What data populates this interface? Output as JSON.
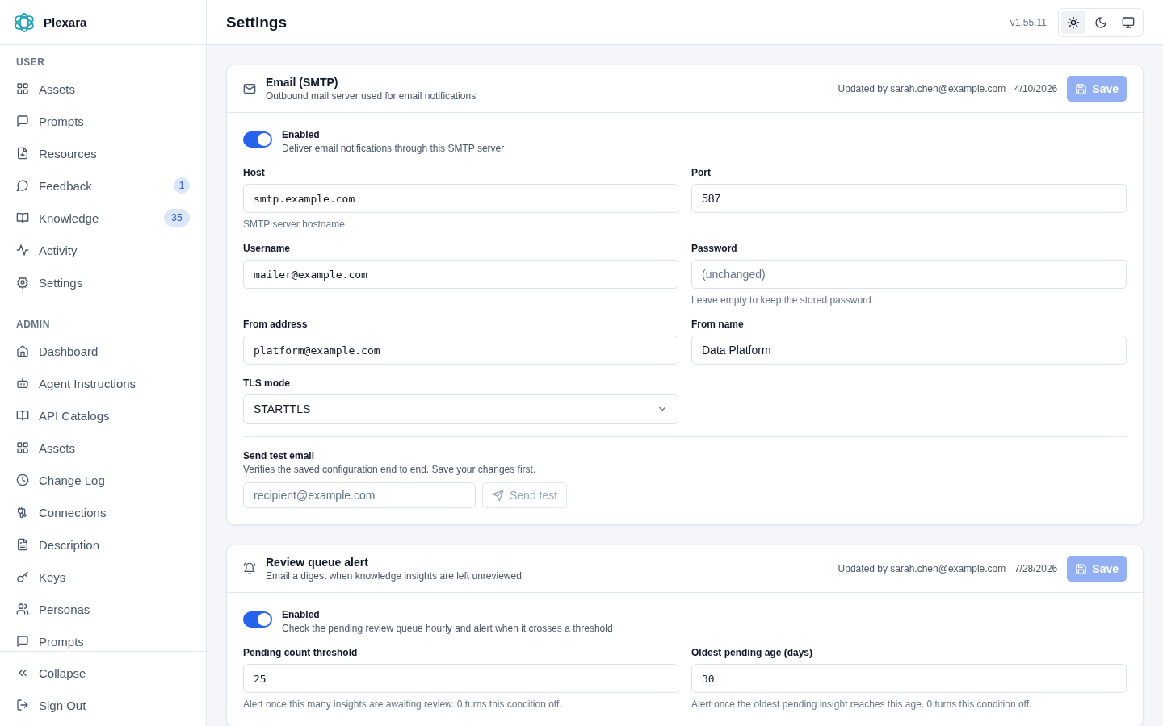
{
  "brand": {
    "name": "Plexara"
  },
  "sidebar": {
    "sections": [
      {
        "title": "USER",
        "items": [
          {
            "label": "Assets",
            "selected": false
          },
          {
            "label": "Prompts",
            "selected": false
          },
          {
            "label": "Resources",
            "selected": false
          },
          {
            "label": "Feedback",
            "selected": false,
            "badge": "1"
          },
          {
            "label": "Knowledge",
            "selected": false,
            "badge": "35"
          },
          {
            "label": "Activity",
            "selected": false
          },
          {
            "label": "Settings",
            "selected": false
          }
        ]
      },
      {
        "title": "ADMIN",
        "items": [
          {
            "label": "Dashboard",
            "selected": false
          },
          {
            "label": "Agent Instructions",
            "selected": false
          },
          {
            "label": "API Catalogs",
            "selected": false
          },
          {
            "label": "Assets",
            "selected": false
          },
          {
            "label": "Change Log",
            "selected": false
          },
          {
            "label": "Connections",
            "selected": false
          },
          {
            "label": "Description",
            "selected": false
          },
          {
            "label": "Keys",
            "selected": false
          },
          {
            "label": "Personas",
            "selected": false
          },
          {
            "label": "Prompts",
            "selected": false
          }
        ]
      }
    ],
    "footer": [
      {
        "label": "Collapse"
      },
      {
        "label": "Sign Out"
      }
    ]
  },
  "header": {
    "title": "Settings",
    "version": "v1.55.11",
    "themes": [
      {
        "selected": true
      },
      {
        "selected": false
      },
      {
        "selected": false
      }
    ]
  },
  "cards": [
    {
      "title": "Email (SMTP)",
      "subtitle": "Outbound mail server used for email notifications",
      "updated": "Updated by sarah.chen@example.com · 4/10/2026",
      "save": {
        "label": "Save",
        "disabled": true
      },
      "toggle": {
        "label": "Enabled",
        "description": "Deliver email notifications through this SMTP server",
        "on": true
      },
      "fields": [
        {
          "kind": "text",
          "label": "Host",
          "value": "smtp.example.com",
          "mono": true,
          "hint": "SMTP server hostname"
        },
        {
          "kind": "text",
          "label": "Port",
          "value": "587",
          "mono": false
        },
        {
          "kind": "text",
          "label": "Username",
          "value": "mailer@example.com",
          "mono": true
        },
        {
          "kind": "password",
          "label": "Password",
          "placeholder": "(unchanged)",
          "mono": false,
          "hint": "Leave empty to keep the stored password"
        },
        {
          "kind": "text",
          "label": "From address",
          "value": "platform@example.com",
          "mono": true
        },
        {
          "kind": "text",
          "label": "From name",
          "value": "Data Platform",
          "mono": false
        },
        {
          "kind": "select",
          "label": "TLS mode",
          "value": "STARTTLS",
          "mono": false
        }
      ],
      "test": {
        "title": "Send test email",
        "description": "Verifies the saved configuration end to end. Save your changes first.",
        "placeholder": "recipient@example.com",
        "button": {
          "label": "Send test",
          "disabled": true
        }
      }
    },
    {
      "title": "Review queue alert",
      "subtitle": "Email a digest when knowledge insights are left unreviewed",
      "updated": "Updated by sarah.chen@example.com · 7/28/2026",
      "save": {
        "label": "Save",
        "disabled": true
      },
      "toggle": {
        "label": "Enabled",
        "description": "Check the pending review queue hourly and alert when it crosses a threshold",
        "on": true
      },
      "fields": [
        {
          "kind": "text",
          "label": "Pending count threshold",
          "value": "25",
          "mono": true,
          "hint": "Alert once this many insights are awaiting review. 0 turns this condition off."
        },
        {
          "kind": "text",
          "label": "Oldest pending age (days)",
          "value": "30",
          "mono": true,
          "hint": "Alert once the oldest pending insight reaches this age. 0 turns this condition off."
        }
      ]
    }
  ]
}
